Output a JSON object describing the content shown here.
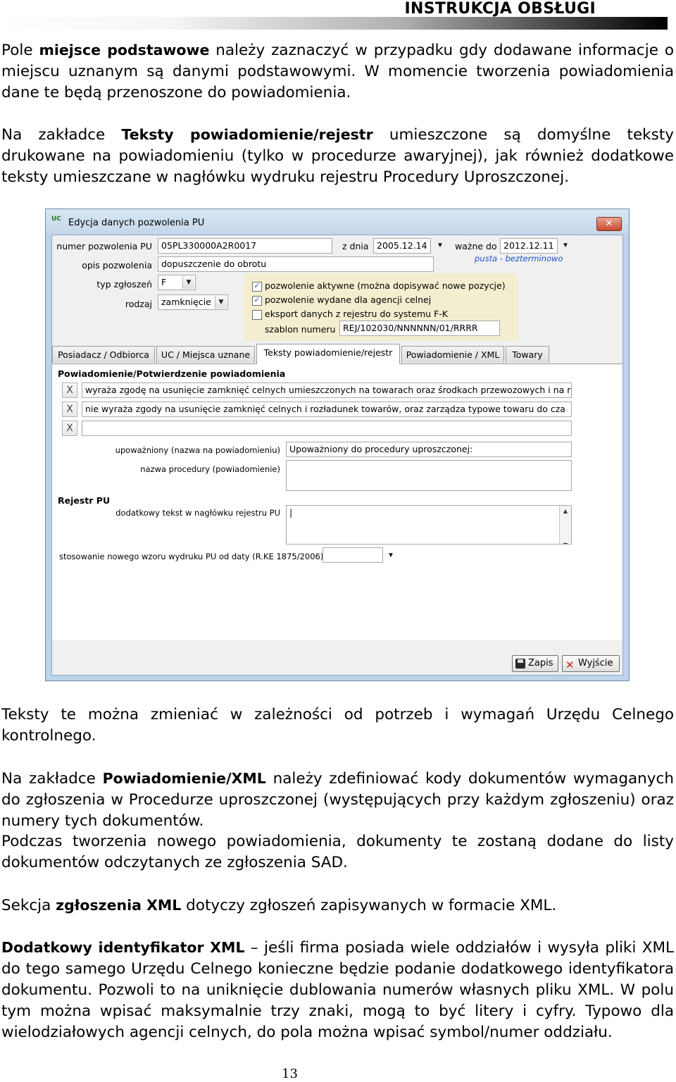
{
  "header": {
    "title": "INSTRUKCJA OBSŁUGI"
  },
  "p1": {
    "pre": "Pole ",
    "bold": "miejsce podstawowe",
    "post": " należy zaznaczyć w przypadku gdy dodawane informacje o miejscu uznanym są danymi podstawowymi.  W momencie tworzenia powiadomienia dane te będą przenoszone do powiadomienia."
  },
  "p2": {
    "pre": "Na zakładce ",
    "bold": "Teksty powiadomienie/rejestr",
    "post": " umieszczone są domyślne teksty drukowane na powiadomieniu (tylko w procedurze awaryjnej), jak również dodatkowe teksty umieszczane w nagłówku wydruku rejestru Procedury Uproszczonej."
  },
  "dialog": {
    "title": "Edycja danych pozwolenia PU",
    "app_icon": "UC",
    "close_glyph": "✕",
    "numer_label": "numer pozwolenia PU",
    "numer_value": "05PL330000A2R0017",
    "zdnia_label": "z dnia",
    "zdnia_value": "2005.12.14",
    "wazne_label": "ważne do",
    "wazne_value": "2012.12.11",
    "link": "pusta - bezterminowo",
    "opis_label": "opis pozwolenia",
    "opis_value": "dopuszczenie do obrotu",
    "typ_label": "typ zgłoszeń",
    "typ_value": "F",
    "rodzaj_label": "rodzaj",
    "rodzaj_value": "zamknięcie",
    "chk1": "pozwolenie aktywne (można dopisywać nowe pozycje)",
    "chk2": "pozwolenie wydane dla agencji celnej",
    "chk3": "eksport danych z rejestru do systemu F-K",
    "check_mark": "✓",
    "szablon_label": "szablon numeru",
    "szablon_value": "REJ/102030/NNNNNN/01/RRRR",
    "tabs": [
      "Posiadacz / Odbiorca",
      "UC / Miejsca uznane",
      "Teksty powiadomienie/rejestr",
      "Powiadomienie / XML",
      "Towary"
    ],
    "section1": "Powiadomienie/Potwierdzenie powiadomienia",
    "x_glyph": "X",
    "text1": "wyraża zgodę na usunięcie zamknięć celnych umieszczonych na towarach oraz środkach przewozowych i na ro",
    "text2": "nie wyraża zgody na usunięcie zamknięć celnych i rozładunek towarów, oraz zarządza typowe towaru do cza",
    "upow_label": "upoważniony (nazwa na powiadomieniu)",
    "upow_value": "Upoważniony do procedury uproszczonej:",
    "nazwa_label": "nazwa procedury (powiadomienie)",
    "section2": "Rejestr PU",
    "dodatkowy_label": "dodatkowy tekst w nagłówku rejestru PU",
    "stosowanie_label": "stosowanie nowego wzoru wydruku PU od daty (R.KE 1875/2006)",
    "save": "Zapis",
    "exit": "Wyjście"
  },
  "p3": "Teksty te można zmieniać w zależności od potrzeb i wymagań Urzędu Celnego kontrolnego.",
  "p4": {
    "pre": "Na zakładce ",
    "bold": "Powiadomienie/XML",
    "post": " należy zdefiniować kody dokumentów wymaganych do zgłoszenia w Procedurze uproszczonej (występujących przy każdym zgłoszeniu) oraz numery tych dokumentów."
  },
  "p5": "Podczas tworzenia nowego powiadomienia, dokumenty te zostaną dodane do listy dokumentów odczytanych ze zgłoszenia SAD.",
  "p6": {
    "pre": "Sekcja ",
    "bold": "zgłoszenia XML",
    "post": "  dotyczy zgłoszeń zapisywanych w formacie XML."
  },
  "p7": {
    "bold": "Dodatkowy identyfikator XML",
    "post": " – jeśli firma posiada wiele oddziałów i wysyła pliki XML do tego samego Urzędu Celnego konieczne będzie podanie dodatkowego identyfikatora dokumentu. Pozwoli to na uniknięcie dublowania numerów własnych pliku XML. W polu tym można wpisać maksymalnie trzy znaki, mogą to być litery i cyfry. Typowo dla wielodziałowych agencji celnych, do pola można wpisać symbol/numer oddziału."
  },
  "page_number": "13"
}
